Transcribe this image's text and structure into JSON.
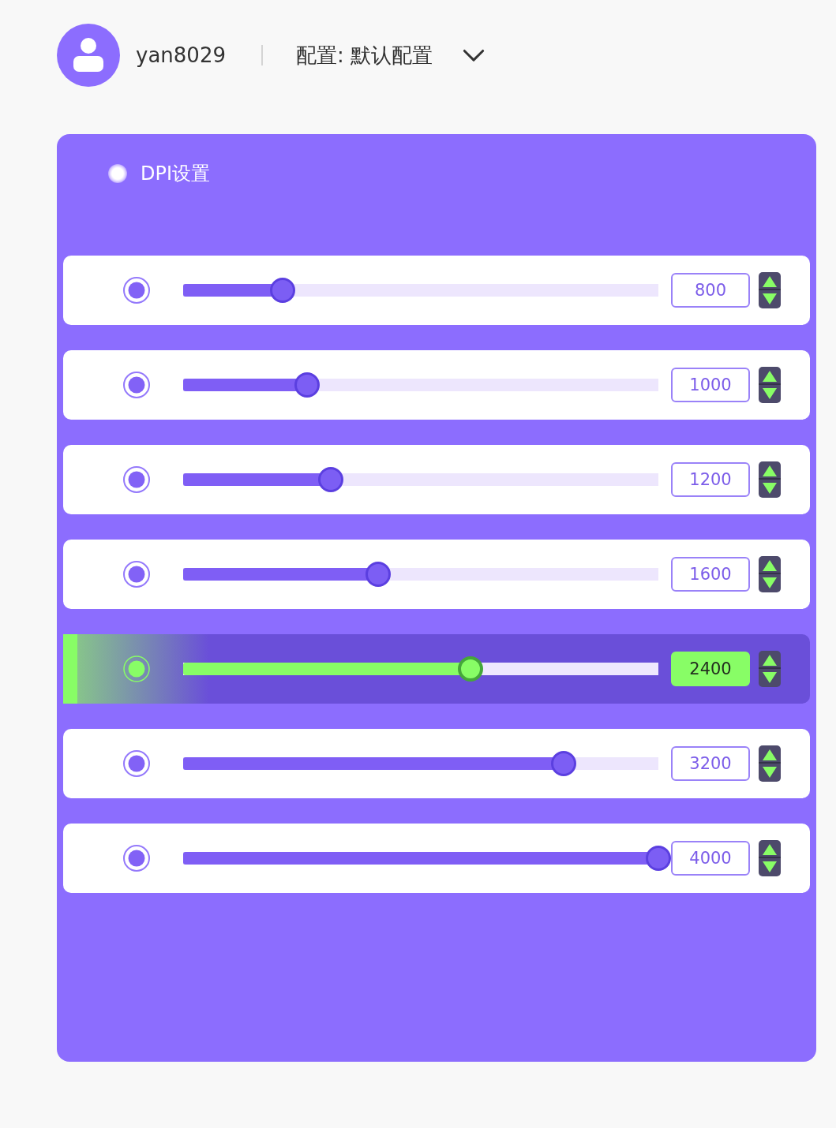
{
  "header": {
    "username": "yan8029",
    "profile_label": "配置: 默认配置"
  },
  "dpi_panel": {
    "title": "DPI设置",
    "rows": [
      {
        "value": "800",
        "level": 0.21,
        "selected": false
      },
      {
        "value": "1000",
        "level": 0.26,
        "selected": false
      },
      {
        "value": "1200",
        "level": 0.31,
        "selected": false
      },
      {
        "value": "1600",
        "level": 0.41,
        "selected": false
      },
      {
        "value": "2400",
        "level": 0.605,
        "selected": true
      },
      {
        "value": "3200",
        "level": 0.8,
        "selected": false
      },
      {
        "value": "4000",
        "level": 1,
        "selected": false
      }
    ]
  }
}
